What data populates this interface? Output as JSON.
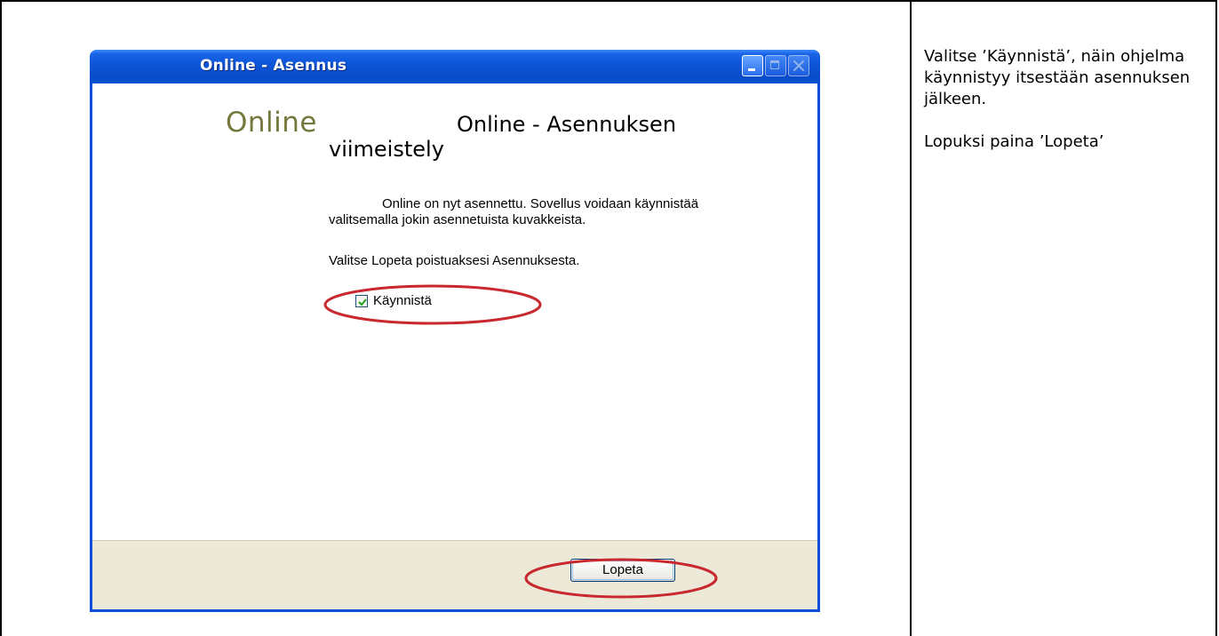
{
  "window": {
    "title": "Online - Asennus",
    "logo_text": "Online",
    "heading_line1": "Online - Asennuksen",
    "heading_line2": "viimeistely",
    "body_line1": "Online on nyt asennettu. Sovellus voidaan käynnistää",
    "body_line2": "valitsemalla jokin asennetuista kuvakkeista.",
    "body_line3": "Valitse Lopeta poistuaksesi Asennuksesta.",
    "checkbox_label": "Käynnistä",
    "checkbox_checked": true,
    "finish_button_label": "Lopeta"
  },
  "instructions": {
    "paragraph1": "Valitse ’Käynnistä’, näin ohjelma käynnistyy itsestään asennuksen jälkeen.",
    "paragraph2": "Lopuksi paina ’Lopeta’"
  },
  "colors": {
    "titlebar": "#0c54d8",
    "logo": "#74783c",
    "annotation": "#c8282e",
    "footer": "#ece9d8"
  }
}
